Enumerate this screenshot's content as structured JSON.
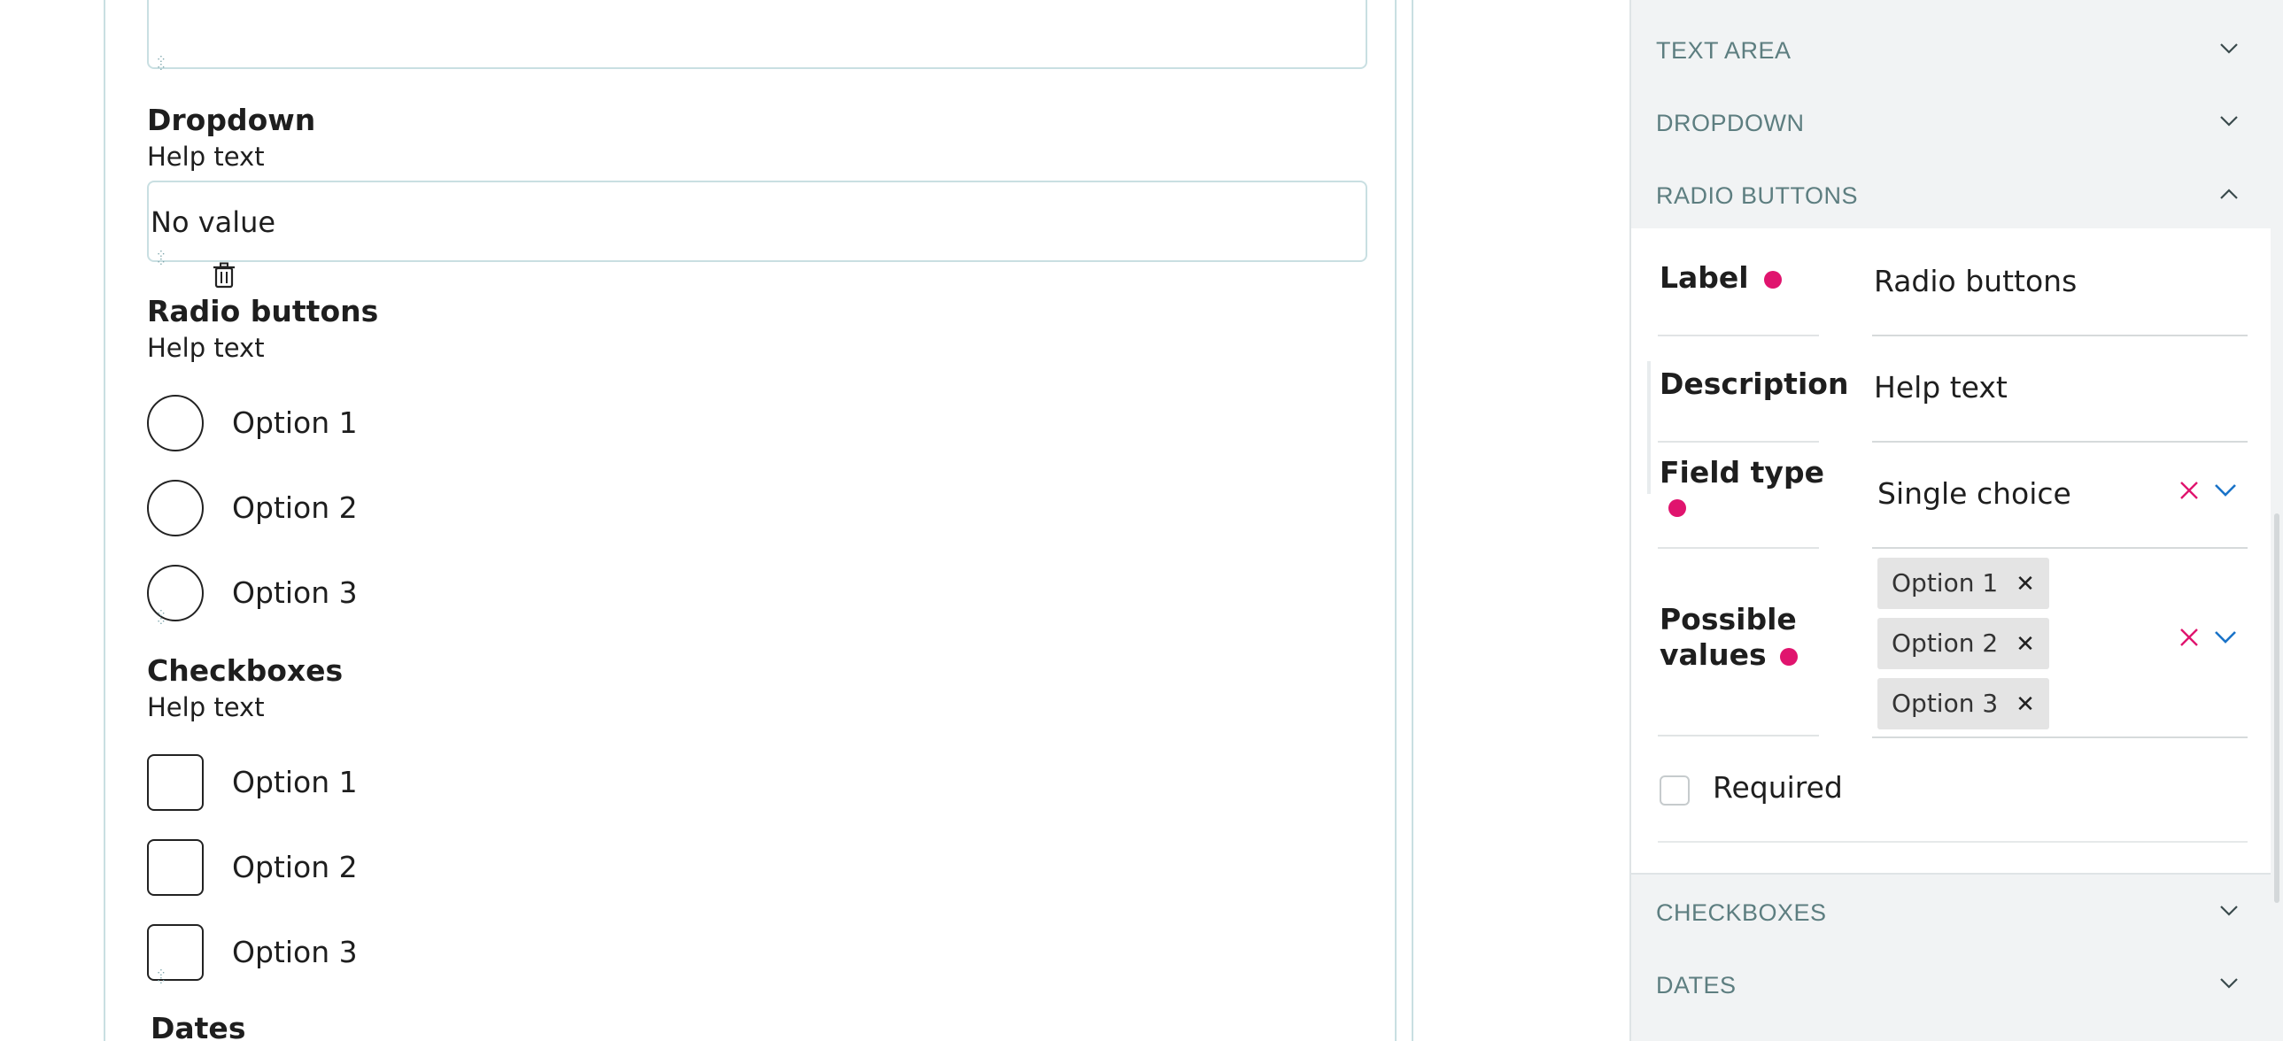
{
  "canvas": {
    "dropdown": {
      "title": "Dropdown",
      "help": "Help text",
      "value": "No value"
    },
    "radio": {
      "title": "Radio buttons",
      "help": "Help text",
      "options": [
        "Option 1",
        "Option 2",
        "Option 3"
      ]
    },
    "checkboxes": {
      "title": "Checkboxes",
      "help": "Help text",
      "options": [
        "Option 1",
        "Option 2",
        "Option 3"
      ]
    },
    "dates": {
      "title": "Dates"
    }
  },
  "panel": {
    "sections": {
      "text_area": "TEXT AREA",
      "dropdown": "DROPDOWN",
      "radio_buttons": "RADIO BUTTONS",
      "checkboxes": "CHECKBOXES",
      "dates": "DATES"
    },
    "form": {
      "label_label": "Label",
      "label_value": "Radio buttons",
      "description_label": "Description",
      "description_value": "Help text",
      "field_type_label": "Field type",
      "field_type_value": "Single choice",
      "possible_values_label_1": "Possible",
      "possible_values_label_2": "values",
      "possible_values": [
        "Option 1",
        "Option 2",
        "Option 3"
      ],
      "required_label": "Required"
    }
  },
  "colors": {
    "accent_required": "#e0146e",
    "section_text": "#5d7e80",
    "chevron_blue": "#1a73c8",
    "clear_red": "#e0146e"
  },
  "icons": {
    "drag_handle": "drag-handle-icon",
    "delete": "trash-icon",
    "expand": "chevron-down-icon",
    "collapse": "chevron-up-icon",
    "clear": "close-icon",
    "remove_chip": "chip-remove-icon"
  }
}
